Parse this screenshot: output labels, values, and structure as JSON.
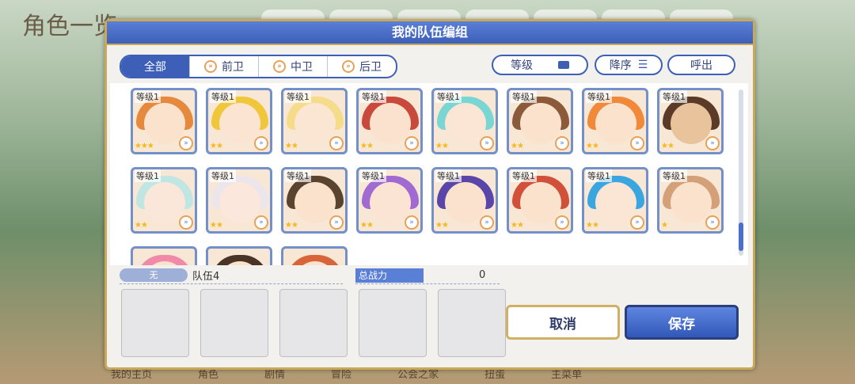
{
  "background": {
    "title": "角色一览",
    "bottom_nav": [
      "我的主页",
      "角色",
      "剧情",
      "冒险",
      "公会之家",
      "扭蛋",
      "主菜单"
    ]
  },
  "dialog": {
    "title": "我的队伍编组",
    "filters": [
      {
        "label": "全部",
        "active": true
      },
      {
        "label": "前卫",
        "icon": "vanguard-icon"
      },
      {
        "label": "中卫",
        "icon": "midguard-icon"
      },
      {
        "label": "后卫",
        "icon": "rearguard-icon"
      }
    ],
    "sort_key": "等级",
    "sort_order": "降序",
    "call_label": "呼出",
    "cards": [
      {
        "level": "等级1",
        "stars": 3,
        "hair": "#e58a3c",
        "face": "#fbe2cd"
      },
      {
        "level": "等级1",
        "stars": 2,
        "hair": "#f0c63a",
        "face": "#fbe5d2"
      },
      {
        "level": "等级1",
        "stars": 2,
        "hair": "#f5dc8a",
        "face": "#fbe6d4"
      },
      {
        "level": "等级1",
        "stars": 2,
        "hair": "#c84a3c",
        "face": "#fbe2cf"
      },
      {
        "level": "等级1",
        "stars": 2,
        "hair": "#7ad6d2",
        "face": "#fbe6d6"
      },
      {
        "level": "等级1",
        "stars": 2,
        "hair": "#8a5a3a",
        "face": "#fbe2cd"
      },
      {
        "level": "等级1",
        "stars": 2,
        "hair": "#f08a3a",
        "face": "#fbe2cd"
      },
      {
        "level": "等级1",
        "stars": 2,
        "hair": "#5c3a28",
        "face": "#e8c39c"
      },
      {
        "level": "等级1",
        "stars": 2,
        "hair": "#bfe6e2",
        "face": "#fbe7da"
      },
      {
        "level": "等级1",
        "stars": 2,
        "hair": "#ece6ec",
        "face": "#fbe7db"
      },
      {
        "level": "等级1",
        "stars": 2,
        "hair": "#5a4430",
        "face": "#fbe2cd"
      },
      {
        "level": "等级1",
        "stars": 2,
        "hair": "#a06ad0",
        "face": "#fbe4d4"
      },
      {
        "level": "等级1",
        "stars": 2,
        "hair": "#5a46a8",
        "face": "#fbe2cf"
      },
      {
        "level": "等级1",
        "stars": 2,
        "hair": "#d0503a",
        "face": "#fbe2cd"
      },
      {
        "level": "等级1",
        "stars": 2,
        "hair": "#3aa6e0",
        "face": "#fbe5d5"
      },
      {
        "level": "等级1",
        "stars": 1,
        "hair": "#d4a07a",
        "face": "#fbe2cd"
      },
      {
        "level": "",
        "stars": 0,
        "hair": "#f08aa8",
        "face": "#fbe2cd"
      },
      {
        "level": "",
        "stars": 0,
        "hair": "#4a3426",
        "face": "#fbe2cd"
      },
      {
        "level": "",
        "stars": 0,
        "hair": "#d8643a",
        "face": "#fbe2cd"
      }
    ],
    "team_badge": "无",
    "team_name": "队伍4",
    "power_label": "总战力",
    "power_value": "0",
    "cancel_label": "取消",
    "save_label": "保存"
  }
}
